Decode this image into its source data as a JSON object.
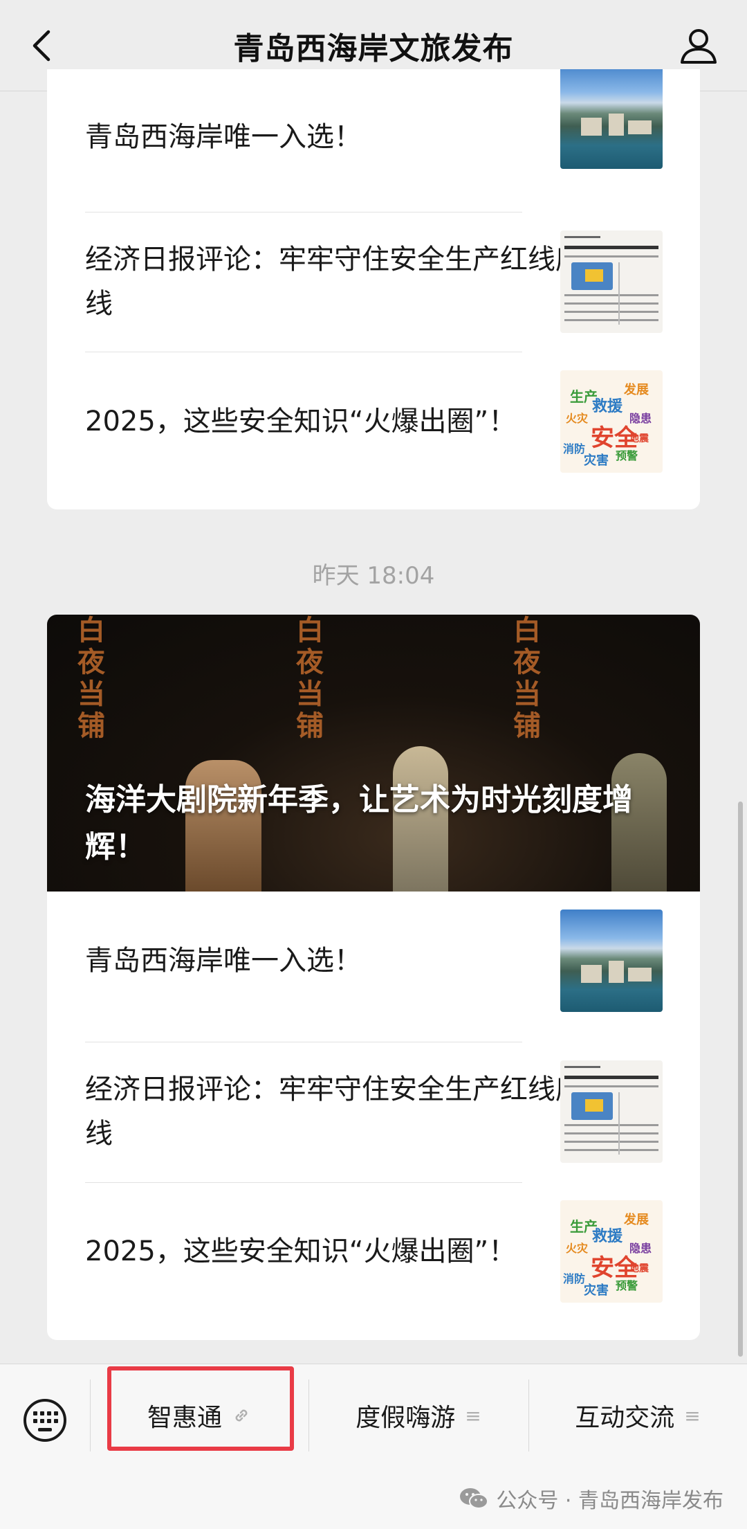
{
  "header": {
    "title": "青岛西海岸文旅发布",
    "back_icon": "chevron-left-icon",
    "profile_icon": "person-icon"
  },
  "card_1": {
    "items": [
      {
        "title": "青岛西海岸唯一入选！",
        "thumb": "coastal-city-photo"
      },
      {
        "title": "经济日报评论：牢牢守住安全生产红线底线",
        "thumb": "newspaper-page"
      },
      {
        "title": "2025，这些安全知识“火爆出圈”！",
        "thumb": "safety-word-cloud"
      }
    ]
  },
  "timestamp": "昨天 18:04",
  "card_2": {
    "hero": {
      "title": "海洋大剧院新年季，让艺术为时光刻度增辉！",
      "sign_text": "白夜当铺"
    },
    "items": [
      {
        "title": "青岛西海岸唯一入选！",
        "thumb": "coastal-city-photo"
      },
      {
        "title": "经济日报评论：牢牢守住安全生产红线底线",
        "thumb": "newspaper-page"
      },
      {
        "title": "2025，这些安全知识“火爆出圈”！",
        "thumb": "safety-word-cloud"
      }
    ]
  },
  "menu": {
    "keyboard_icon": "keyboard-icon",
    "items": [
      {
        "label": "智惠通",
        "icon": "link-icon",
        "highlighted": true
      },
      {
        "label": "度假嗨游",
        "icon": "menu-lines-icon"
      },
      {
        "label": "互动交流",
        "icon": "menu-lines-icon"
      }
    ]
  },
  "footer": {
    "credit": "公众号 · 青岛西海岸发布",
    "icon": "wechat-icon"
  },
  "colors": {
    "highlight_border": "#e93b46",
    "background": "#ededed"
  }
}
